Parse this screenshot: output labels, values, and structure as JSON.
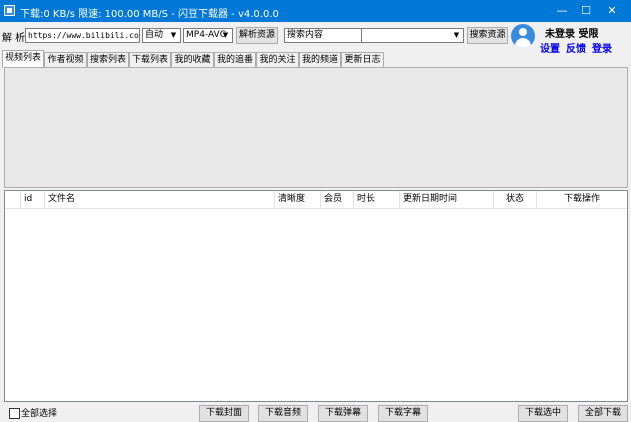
{
  "window": {
    "title": "下载:0 KB/s   限速: 100.00 MB/S  - 闪豆下载器 - v4.0.0.0",
    "minimize": "—",
    "maximize": "☐",
    "close": "✕"
  },
  "parse_bar": {
    "label": "解 析:",
    "url_value": "https://www.bilibili.com/v",
    "quality_select": "自动",
    "codec_select": "MP4-AVC",
    "parse_button": "解析资源",
    "search_placeholder": "搜索内容",
    "search_button": "搜索资源"
  },
  "user": {
    "status": "未登录  受限",
    "settings_link": "设置",
    "feedback_link": "反馈",
    "login_link": "登录"
  },
  "tabs": [
    {
      "label": "视频列表",
      "active": true
    },
    {
      "label": "作者视频"
    },
    {
      "label": "搜索列表"
    },
    {
      "label": "下载列表"
    },
    {
      "label": "我的收藏"
    },
    {
      "label": "我的追番"
    },
    {
      "label": "我的关注"
    },
    {
      "label": "我的频道"
    },
    {
      "label": "更新日志"
    }
  ],
  "table": {
    "columns": [
      "",
      "id",
      "文件名",
      "清晰度",
      "会员",
      "时长",
      "更新日期时间",
      "状态",
      "下载操作"
    ],
    "rows": []
  },
  "footer": {
    "select_all": "全部选择",
    "download_cover": "下载封面",
    "download_audio": "下载音频",
    "download_danmaku": "下载弹幕",
    "download_subtitle": "下载字幕",
    "download_selected": "下载选中",
    "download_all": "全部下载"
  }
}
